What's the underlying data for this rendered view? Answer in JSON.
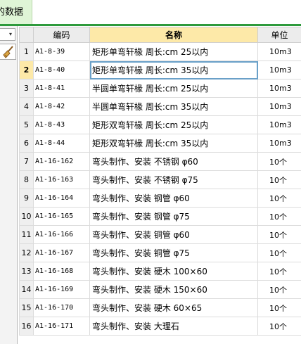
{
  "tab": {
    "label": "的数据"
  },
  "left_panel": {
    "dropdown_arrow": "▾",
    "broom_icon": "broom-icon"
  },
  "table": {
    "headers": {
      "code": "编码",
      "name": "名称",
      "unit": "单位"
    },
    "rows": [
      {
        "index": "1",
        "code": "A1-8-39",
        "name": "矩形单弯轩椽 周长:cm 25以内",
        "unit": "10m3"
      },
      {
        "index": "2",
        "code": "A1-8-40",
        "name": "矩形单弯轩椽 周长:cm 35以内",
        "unit": "10m3"
      },
      {
        "index": "3",
        "code": "A1-8-41",
        "name": "半圆单弯轩椽 周长:cm 25以内",
        "unit": "10m3"
      },
      {
        "index": "4",
        "code": "A1-8-42",
        "name": "半圆单弯轩椽 周长:cm 35以内",
        "unit": "10m3"
      },
      {
        "index": "5",
        "code": "A1-8-43",
        "name": "矩形双弯轩椽 周长:cm 25以内",
        "unit": "10m3"
      },
      {
        "index": "6",
        "code": "A1-8-44",
        "name": "矩形双弯轩椽 周长:cm 35以内",
        "unit": "10m3"
      },
      {
        "index": "7",
        "code": "A1-16-162",
        "name": "弯头制作、安装 不锈钢 φ60",
        "unit": "10个"
      },
      {
        "index": "8",
        "code": "A1-16-163",
        "name": "弯头制作、安装 不锈钢 φ75",
        "unit": "10个"
      },
      {
        "index": "9",
        "code": "A1-16-164",
        "name": "弯头制作、安装 钢管 φ60",
        "unit": "10个"
      },
      {
        "index": "10",
        "code": "A1-16-165",
        "name": "弯头制作、安装 钢管 φ75",
        "unit": "10个"
      },
      {
        "index": "11",
        "code": "A1-16-166",
        "name": "弯头制作、安装 铜管 φ60",
        "unit": "10个"
      },
      {
        "index": "12",
        "code": "A1-16-167",
        "name": "弯头制作、安装 铜管 φ75",
        "unit": "10个"
      },
      {
        "index": "13",
        "code": "A1-16-168",
        "name": "弯头制作、安装 硬木 100×60",
        "unit": "10个"
      },
      {
        "index": "14",
        "code": "A1-16-169",
        "name": "弯头制作、安装 硬木 150×60",
        "unit": "10个"
      },
      {
        "index": "15",
        "code": "A1-16-170",
        "name": "弯头制作、安装 硬木 60×65",
        "unit": "10个"
      },
      {
        "index": "16",
        "code": "A1-16-171",
        "name": "弯头制作、安装 大理石",
        "unit": "10个"
      }
    ]
  },
  "colors": {
    "accent_green": "#2e9a3c",
    "header_highlight": "#fde9a8",
    "selection": "#6aa0c8"
  }
}
